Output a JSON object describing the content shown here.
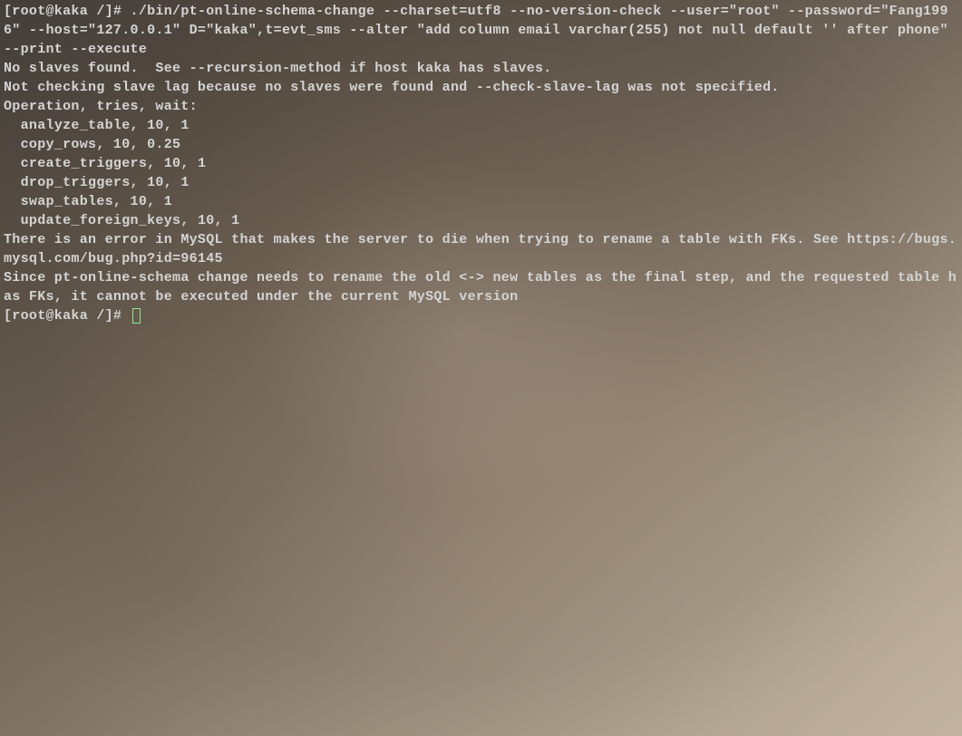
{
  "terminal": {
    "prompt1": "[root@kaka /]# ",
    "command": "./bin/pt-online-schema-change --charset=utf8 --no-version-check --user=\"root\" --password=\"Fang1996\" --host=\"127.0.0.1\" D=\"kaka\",t=evt_sms --alter \"add column email varchar(255) not null default '' after phone\" --print --execute",
    "output": {
      "line1": "No slaves found.  See --recursion-method if host kaka has slaves.",
      "line2": "Not checking slave lag because no slaves were found and --check-slave-lag was not specified.",
      "line3": "Operation, tries, wait:",
      "line4": "  analyze_table, 10, 1",
      "line5": "  copy_rows, 10, 0.25",
      "line6": "  create_triggers, 10, 1",
      "line7": "  drop_triggers, 10, 1",
      "line8": "  swap_tables, 10, 1",
      "line9": "  update_foreign_keys, 10, 1",
      "line10": "There is an error in MySQL that makes the server to die when trying to rename a table with FKs. See https://bugs.mysql.com/bug.php?id=96145",
      "line11": "Since pt-online-schema change needs to rename the old <-> new tables as the final step, and the requested table has FKs, it cannot be executed under the current MySQL version"
    },
    "prompt2": "[root@kaka /]# "
  }
}
